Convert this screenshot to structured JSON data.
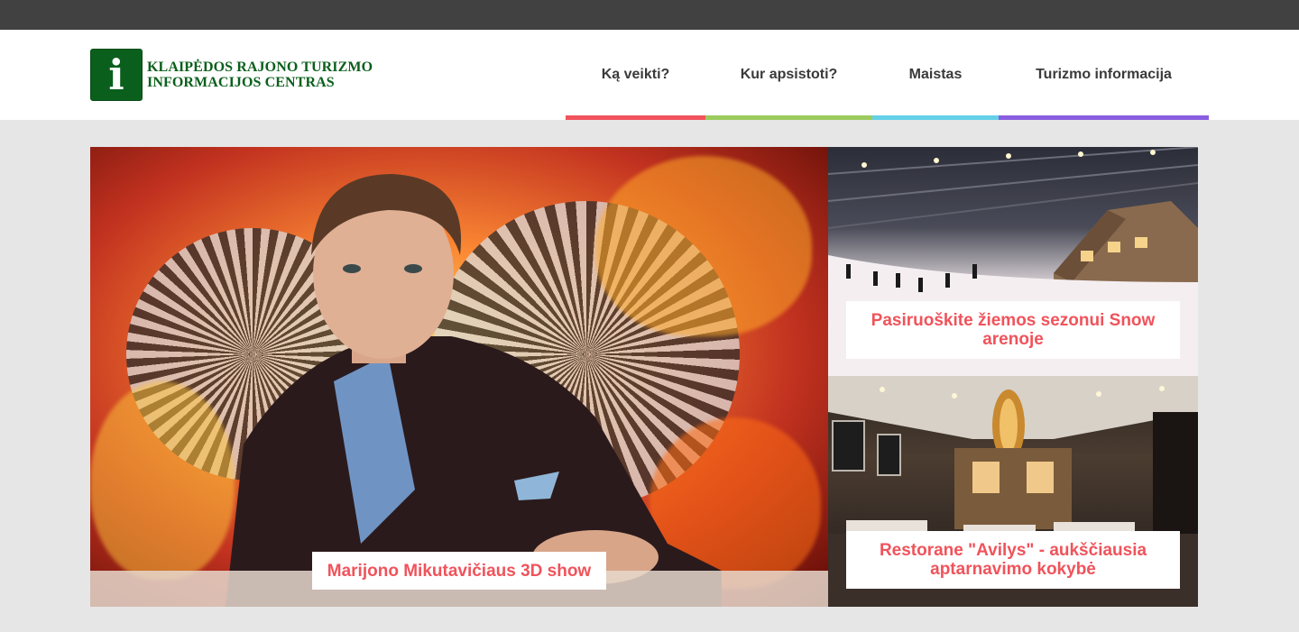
{
  "logo": {
    "icon_letter": "i",
    "line1": "KLAIPĖDOS RAJONO TURIZMO",
    "line2": "INFORMACIJOS CENTRAS",
    "color": "#0b5f1c"
  },
  "nav": {
    "items": [
      {
        "label": "Ką veikti?",
        "accent": "#f0535b"
      },
      {
        "label": "Kur apsistoti?",
        "accent": "#9bcb5d"
      },
      {
        "label": "Maistas",
        "accent": "#64d0e8"
      },
      {
        "label": "Turizmo informacija",
        "accent": "#8a5ee0"
      }
    ]
  },
  "hero": {
    "main": {
      "caption": "Marijono Mikutavičiaus 3D show"
    },
    "snow": {
      "caption": "Pasiruoškite žiemos sezonui Snow arenoje"
    },
    "restaurant": {
      "caption": "Restorane \"Avilys\" - aukščiausia aptarnavimo kokybė"
    }
  },
  "colors": {
    "topbar": "#414141",
    "page_bg": "#e6e6e6",
    "caption_text": "#f0535b"
  }
}
